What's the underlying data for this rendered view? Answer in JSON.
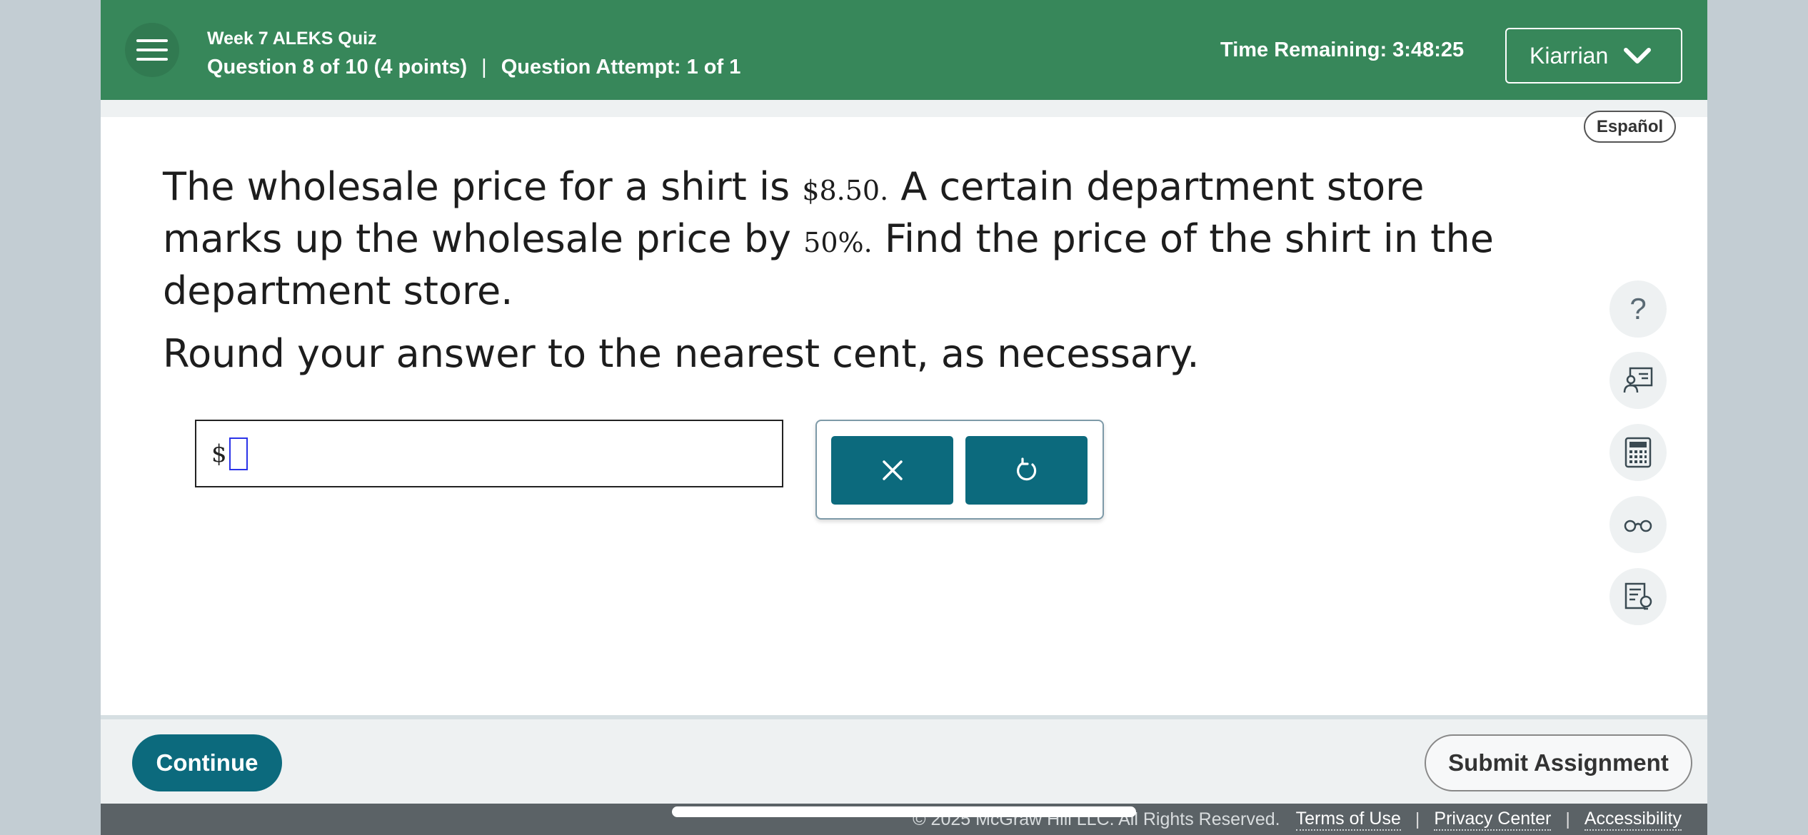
{
  "header": {
    "quiz_title": "Week 7 ALEKS Quiz",
    "question_info": "Question 8 of 10 (4 points)",
    "separator": "|",
    "attempt_info": "Question Attempt: 1 of 1",
    "time_remaining": "Time Remaining: 3:48:25",
    "user_name": "Kiarrian"
  },
  "language_button": "Español",
  "question": {
    "part1": "The wholesale price for a shirt is ",
    "price": "$8.50.",
    "part2": " A certain department store marks up the wholesale price by ",
    "percent": "50%.",
    "part3": " Find the price of the shirt in the department store.",
    "instruction": "Round your answer to the nearest cent, as necessary."
  },
  "answer": {
    "prefix": "$",
    "value": ""
  },
  "tools": {
    "help_label": "?"
  },
  "footer": {
    "continue_label": "Continue",
    "submit_label": "Submit Assignment",
    "copyright": "© 2025 McGraw Hill LLC. All Rights Reserved.",
    "terms": "Terms of Use",
    "privacy": "Privacy Center",
    "accessibility": "Accessibility",
    "pipe": "|"
  },
  "colors": {
    "header": "#37875a",
    "primary_button": "#0c6a7d",
    "footer_dark": "#5b6266"
  }
}
